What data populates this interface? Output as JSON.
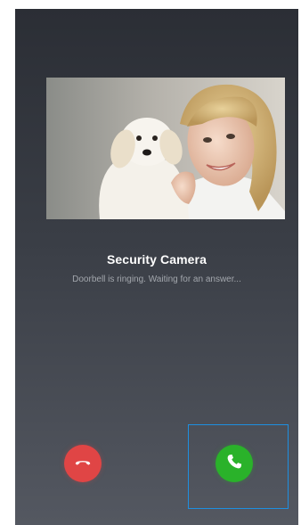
{
  "call": {
    "caller_name": "Security Camera",
    "status_text": "Doorbell is ringing. Waiting for an answer..."
  },
  "controls": {
    "decline_icon": "phone-hangup-icon",
    "accept_icon": "phone-icon"
  },
  "colors": {
    "background_top": "#2b2e35",
    "background_bottom": "#545861",
    "decline": "#e04545",
    "accept": "#2ab22a",
    "focus_outline": "#1e8fe0"
  }
}
